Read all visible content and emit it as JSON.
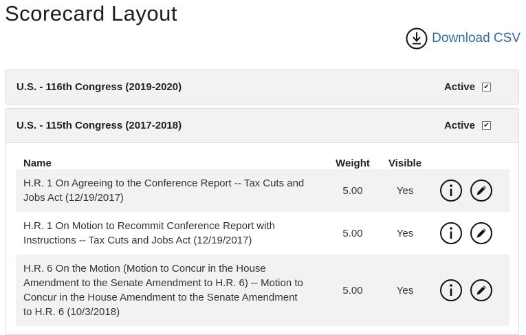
{
  "page": {
    "title": "Scorecard Layout",
    "download_label": "Download CSV",
    "accent_color": "#2e6da4"
  },
  "panels": [
    {
      "title": "U.S. - 116th Congress (2019-2020)",
      "active_label": "Active",
      "active_checked": true,
      "checkbox_glyph": "✔",
      "expanded": false
    },
    {
      "title": "U.S. - 115th Congress (2017-2018)",
      "active_label": "Active",
      "active_checked": true,
      "checkbox_glyph": "✔",
      "expanded": true,
      "table": {
        "headers": {
          "name": "Name",
          "weight": "Weight",
          "visible": "Visible"
        },
        "rows": [
          {
            "name": "H.R. 1 On Agreeing to the Conference Report -- Tax Cuts and Jobs Act (12/19/2017)",
            "weight": "5.00",
            "visible": "Yes"
          },
          {
            "name": "H.R. 1 On Motion to Recommit Conference Report with Instructions -- Tax Cuts and Jobs Act (12/19/2017)",
            "weight": "5.00",
            "visible": "Yes"
          },
          {
            "name": "H.R. 6 On the Motion (Motion to Concur in the House Amendment to the Senate Amendment to H.R. 6) -- Motion to Concur in the House Amendment to the Senate Amendment to H.R. 6 (10/3/2018)",
            "weight": "5.00",
            "visible": "Yes"
          }
        ]
      }
    }
  ],
  "icons": {
    "download": "download-circle-icon",
    "info": "info-circle-icon",
    "edit": "pencil-circle-icon"
  }
}
